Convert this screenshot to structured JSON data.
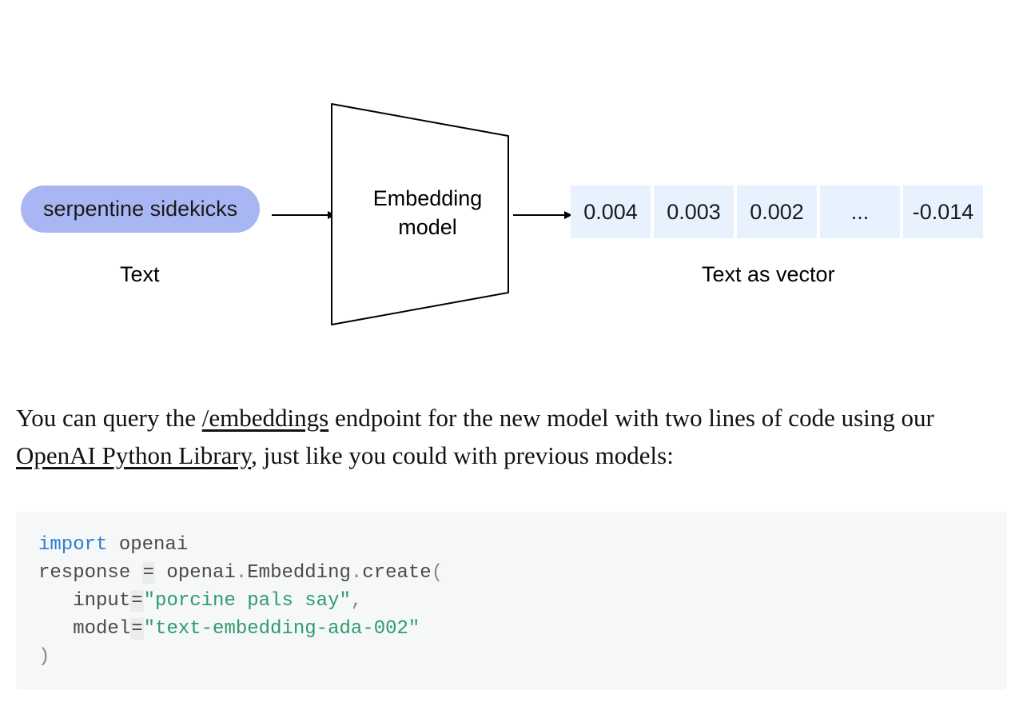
{
  "diagram": {
    "input_text": "serpentine sidekicks",
    "input_label": "Text",
    "model_label_line1": "Embedding",
    "model_label_line2": "model",
    "vector_label": "Text as vector",
    "vector": [
      "0.004",
      "0.003",
      "0.002",
      "...",
      "-0.014"
    ]
  },
  "paragraph": {
    "part1": "You can query the ",
    "link1": "/embeddings",
    "part2": " endpoint for the new model with two lines of code using our ",
    "link2": "OpenAI Python Library",
    "part3": ", just like you could with previous models:"
  },
  "code": {
    "kw_import": "import",
    "mod": " openai",
    "line2a": "response ",
    "eq": "=",
    "line2b": " openai",
    "dot1": ".",
    "emb": "Embedding",
    "dot2": ".",
    "create": "create",
    "open_paren": "(",
    "indent": "   ",
    "input_kw": "input",
    "eq2": "=",
    "input_str": "\"porcine pals say\"",
    "comma": ",",
    "model_kw": "model",
    "eq3": "=",
    "model_str": "\"text-embedding-ada-002\"",
    "close_paren": ")"
  }
}
